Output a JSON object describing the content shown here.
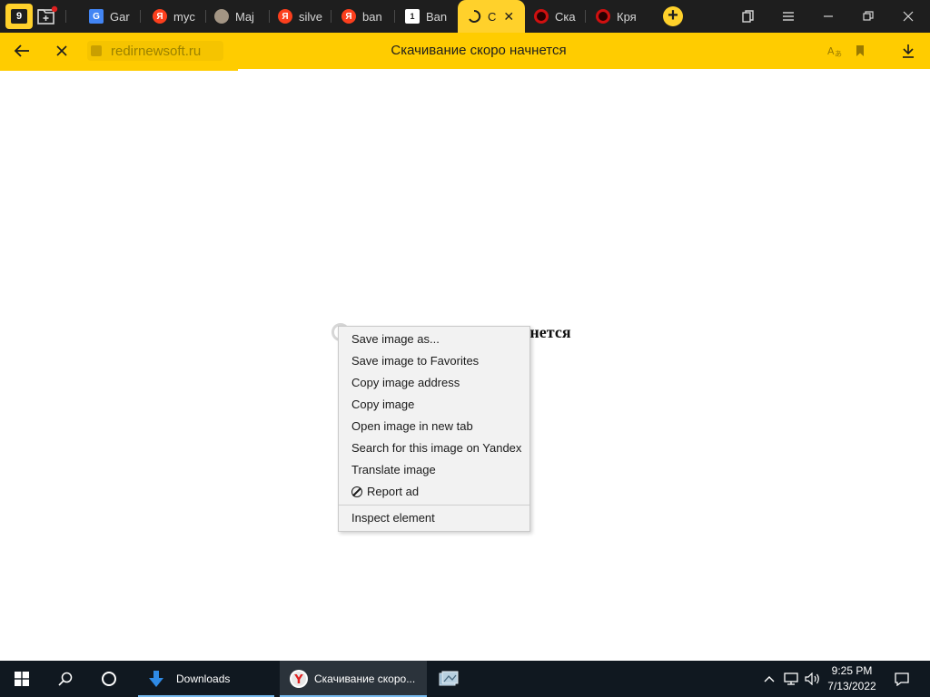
{
  "tabbar": {
    "home_badge": "9",
    "tabs": [
      {
        "label": "Gar",
        "favicon": "google-g",
        "color": "#4285f4",
        "glyph": "G"
      },
      {
        "label": "myc",
        "favicon": "yandex-ya",
        "color": "#fc3f1d",
        "glyph": "Я"
      },
      {
        "label": "Maj",
        "favicon": "image-thumb",
        "color": "#8a7a6a",
        "glyph": ""
      },
      {
        "label": "silve",
        "favicon": "yandex-ya",
        "color": "#fc3f1d",
        "glyph": "Я"
      },
      {
        "label": "ban",
        "favicon": "yandex-ya",
        "color": "#fc3f1d",
        "glyph": "Я"
      },
      {
        "label": "Ban",
        "favicon": "number-one",
        "color": "#ffffff",
        "glyph": "1"
      },
      {
        "label": "С",
        "favicon": "loading-spinner",
        "color": "#1e1e1e",
        "glyph": "",
        "active": true
      },
      {
        "label": "Ска",
        "favicon": "red-record",
        "color": "#d01010",
        "glyph": ""
      },
      {
        "label": "Кря",
        "favicon": "red-record",
        "color": "#d01010",
        "glyph": ""
      }
    ],
    "close_glyph": "✕"
  },
  "addressbar": {
    "url": "redirnewsoft.ru",
    "page_title": "Скачивание скоро начнется"
  },
  "page": {
    "heading_visible": "ачнется"
  },
  "context_menu": {
    "items": [
      {
        "label": "Save image as..."
      },
      {
        "label": "Save image to Favorites"
      },
      {
        "label": "Copy image address"
      },
      {
        "label": "Copy image"
      },
      {
        "label": "Open image in new tab"
      },
      {
        "label": "Search for this image on Yandex"
      },
      {
        "label": "Translate image"
      },
      {
        "label": "Report ad",
        "icon": "ban-icon"
      }
    ],
    "footer_item": "Inspect element"
  },
  "taskbar": {
    "apps": [
      {
        "label": "Downloads",
        "icon": "download-folder-icon"
      },
      {
        "label": "Скачивание скоро...",
        "icon": "yandex-browser-icon"
      }
    ],
    "clock_time": "9:25 PM",
    "clock_date": "7/13/2022"
  },
  "colors": {
    "accent": "#ffcc00",
    "tabbar_bg": "#1e1e1e",
    "taskbar_bg": "#101820"
  }
}
